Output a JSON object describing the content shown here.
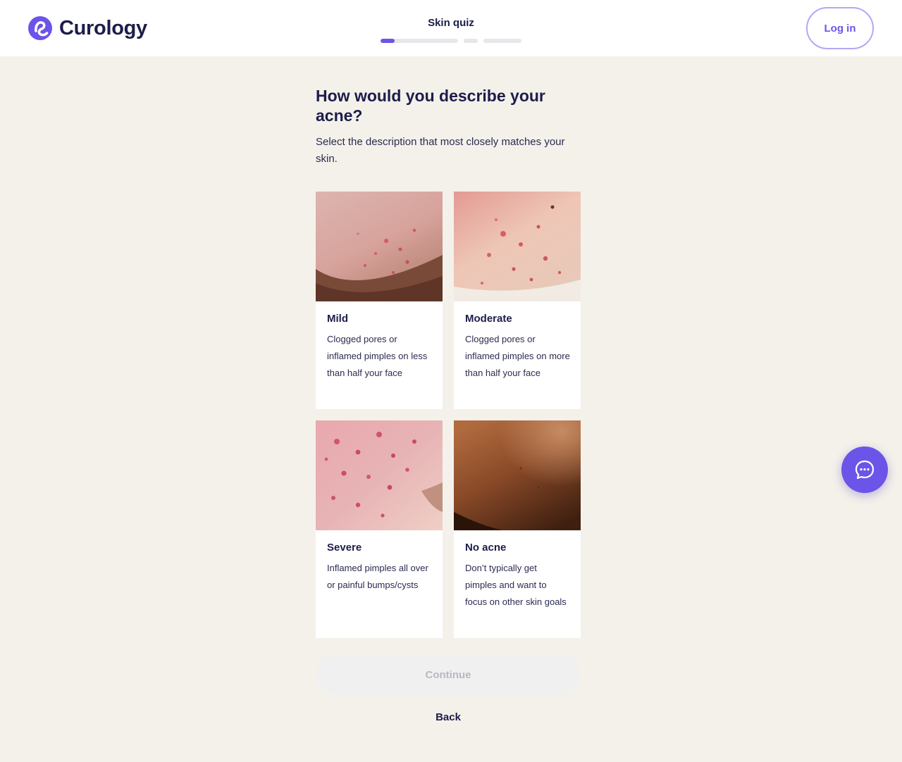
{
  "brand": {
    "name": "Curology",
    "accent": "#6b54e8",
    "ink": "#1c1d4a"
  },
  "header": {
    "quiz_title": "Skin quiz",
    "progress": [
      {
        "fill": 0.18
      },
      {
        "fill": 0
      },
      {
        "fill": 0
      }
    ],
    "login_label": "Log in"
  },
  "question": {
    "title": "How would you describe your acne?",
    "subtitle": "Select the description that most closely matches your skin."
  },
  "options": [
    {
      "label": "Mild",
      "description": "Clogged pores or inflamed pimples on less than half your face"
    },
    {
      "label": "Moderate",
      "description": "Clogged pores or inflamed pimples on more than half your face"
    },
    {
      "label": "Severe",
      "description": "Inflamed pimples all over or painful bumps/cysts"
    },
    {
      "label": "No acne",
      "description": "Don’t typically get pimples and want to focus on other skin goals"
    }
  ],
  "actions": {
    "continue_label": "Continue",
    "back_label": "Back"
  },
  "icons": {
    "chat": "chat-bubble-icon",
    "logo": "curology-logo-icon"
  }
}
